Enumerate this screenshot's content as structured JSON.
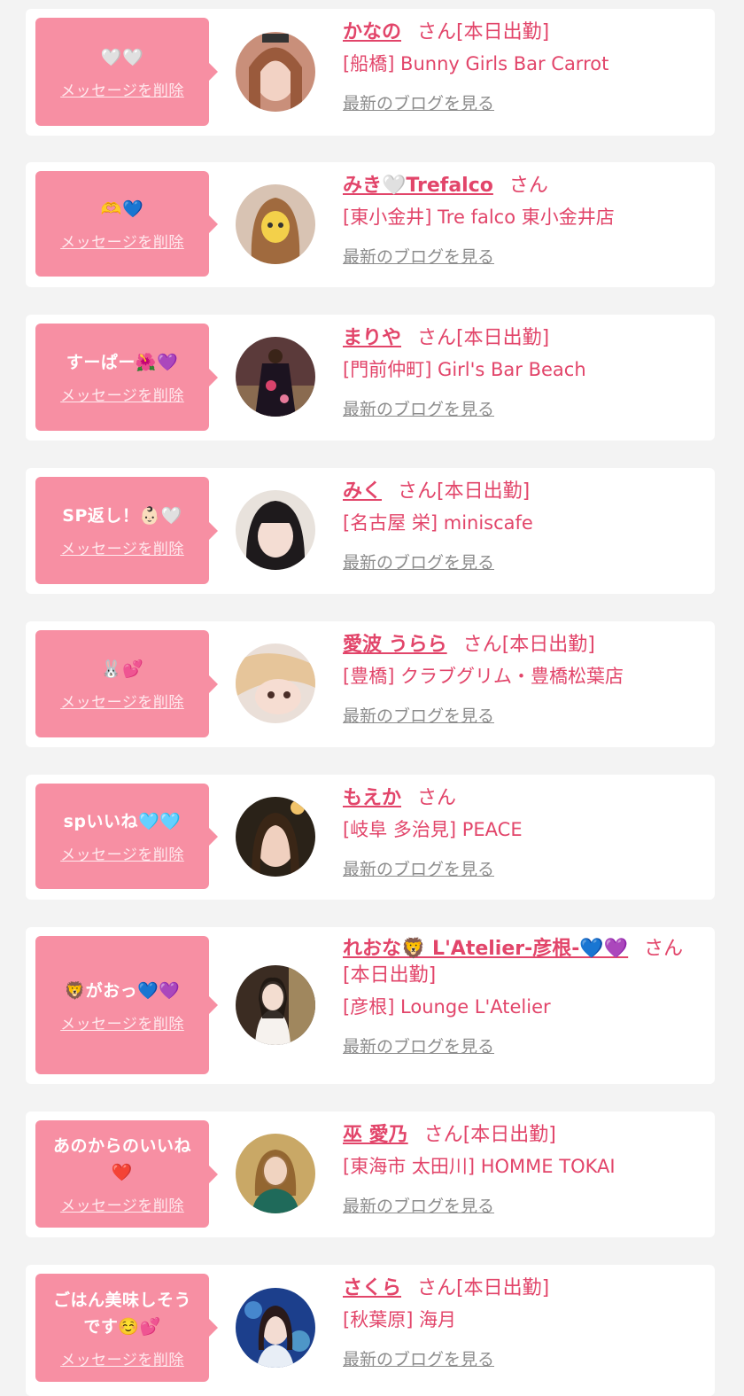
{
  "colors": {
    "accent": "#e2456a",
    "bubble": "#f78fa3",
    "link_gray": "#8c8c8c",
    "bg": "#f3f3f3"
  },
  "delete_label": "メッセージを削除",
  "blog_label": "最新のブログを見る",
  "san_label": "さん",
  "cards": [
    {
      "message": "🤍🤍",
      "name": "かなの",
      "status": "[本日出勤]",
      "shop": "[船橋] Bunny Girls Bar Carrot"
    },
    {
      "message": "🫶💙",
      "name": "みき🤍Trefalco",
      "status": "",
      "shop": "[東小金井] Tre falco 東小金井店"
    },
    {
      "message": "すーぱー🌺💜",
      "name": "まりや",
      "status": "[本日出勤]",
      "shop": "[門前仲町] Girl's Bar Beach"
    },
    {
      "message": "SP返し！👶🏻🤍",
      "name": "みく",
      "status": "[本日出勤]",
      "shop": "[名古屋 栄] miniscafe"
    },
    {
      "message": "🐰💕",
      "name": "愛波 うらら",
      "status": "[本日出勤]",
      "shop": "[豊橋] クラブグリム・豊橋松葉店"
    },
    {
      "message": "spいいね🩵🩵",
      "name": "もえか",
      "status": "",
      "shop": "[岐阜 多治見] PEACE"
    },
    {
      "message": "🦁がおっ💙💜",
      "name": "れおな🦁 L'Atelier-彦根-💙💜",
      "status": "[本日出勤]",
      "shop": "[彦根] Lounge L'Atelier"
    },
    {
      "message": "あのからのいいね\n❤️",
      "name": "巫 愛乃",
      "status": "[本日出勤]",
      "shop": "[東海市 太田川] HOMME TOKAI"
    },
    {
      "message": "ごはん美味しそう\nです☺️💕",
      "name": "さくら",
      "status": "[本日出勤]",
      "shop": "[秋葉原] 海月"
    }
  ]
}
